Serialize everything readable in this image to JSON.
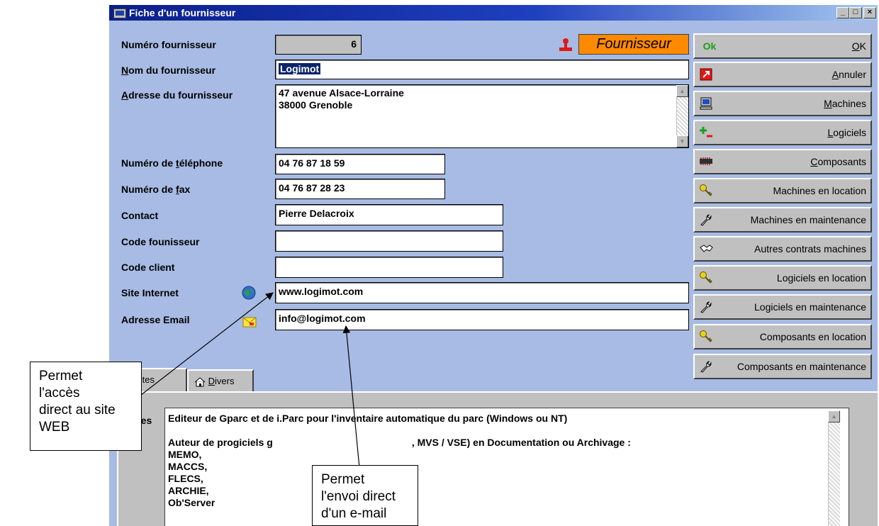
{
  "window": {
    "title": "Fiche d'un fournisseur",
    "controls": {
      "minimize": "_",
      "maximize": "□",
      "close": "×"
    }
  },
  "form": {
    "numero": {
      "label": "Numéro fournisseur",
      "value": "6"
    },
    "nom": {
      "label_u": "N",
      "label_rest": "om du fournisseur",
      "value": "Logimot"
    },
    "adresse": {
      "label_u": "A",
      "label_rest": "dresse du fournisseur",
      "value": "47 avenue Alsace-Lorraine\n38000 Grenoble"
    },
    "telephone": {
      "label_pre": "Numéro de ",
      "label_u": "t",
      "label_rest": "éléphone",
      "value": "04 76 87 18 59"
    },
    "fax": {
      "label_pre": "Numéro de ",
      "label_u": "f",
      "label_rest": "ax",
      "value": "04 76 87 28 23"
    },
    "contact": {
      "label": "Contact",
      "value": "Pierre Delacroix"
    },
    "code_fournisseur": {
      "label": "Code founisseur",
      "value": ""
    },
    "code_client": {
      "label": "Code client",
      "value": ""
    },
    "site": {
      "label": "Site Internet",
      "value": "www.logimot.com"
    },
    "email": {
      "label": "Adresse Email",
      "value": "info@logimot.com"
    },
    "badge": "Fournisseur"
  },
  "buttons": {
    "ok": {
      "icon": "Ok",
      "u": "O",
      "rest": "K"
    },
    "annuler": {
      "u": "A",
      "rest": "nnuler"
    },
    "machines": {
      "u": "M",
      "rest": "achines"
    },
    "logiciels": {
      "u": "L",
      "rest": "ogiciels"
    },
    "composants": {
      "u": "C",
      "rest": "omposants"
    },
    "machines_location": "Machines en location",
    "machines_maintenance": "Machines en maintenance",
    "autres_contrats": "Autres contrats machines",
    "logiciels_location": "Logiciels en location",
    "logiciels_maintenance": "Logiciels en maintenance",
    "composants_location": "Composants en location",
    "composants_maintenance": "Composants en maintenance"
  },
  "tabs": {
    "notes": {
      "u": "N",
      "rest": "otes"
    },
    "divers": {
      "u": "D",
      "rest": "ivers"
    }
  },
  "notes": {
    "label": "tes",
    "line1": "Editeur de Gparc et de i.Parc pour l'inventaire automatique du parc (Windows ou NT)",
    "line2_a": "Auteur de progiciels g",
    "line2_b": ", MVS / VSE) en Documentation ou Archivage :",
    "items": "MEMO,\nMACCS,\nFLECS,\nARCHIE,\nOb'Server"
  },
  "callouts": {
    "web": "Permet\nl'accès\ndirect au site\nWEB",
    "mail": "Permet\nl'envoi direct\nd'un e-mail"
  },
  "colors": {
    "window_bg": "#a7bbe4",
    "titlebar": "#0a1f8a",
    "badge_bg": "#ff8a00",
    "selection": "#0a246a"
  }
}
